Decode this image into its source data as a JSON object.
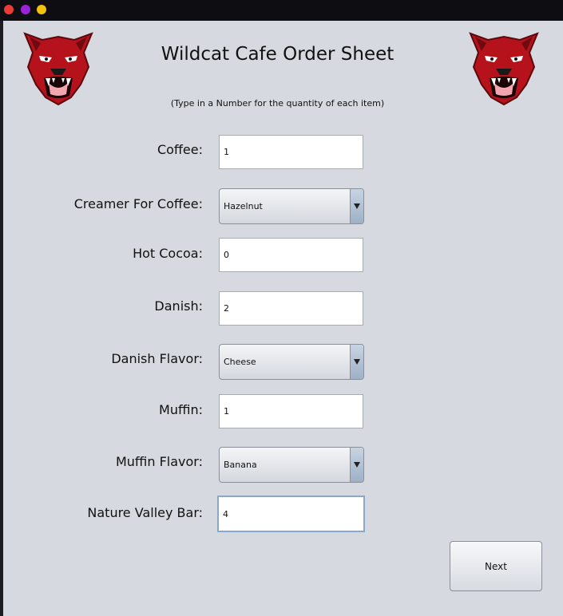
{
  "window": {
    "controls": [
      "close-dot",
      "minimize-dot",
      "maximize-dot"
    ]
  },
  "header": {
    "title": "Wildcat Cafe Order Sheet",
    "subtitle": "(Type in a Number for the quantity of each item)",
    "logo_icon": "wildcat-mascot-icon"
  },
  "form": {
    "coffee": {
      "label": "Coffee:",
      "value": "1"
    },
    "creamer": {
      "label": "Creamer For Coffee:",
      "value": "Hazelnut"
    },
    "hot_cocoa": {
      "label": "Hot Cocoa:",
      "value": "0"
    },
    "danish": {
      "label": "Danish:",
      "value": "2"
    },
    "danish_flavor": {
      "label": "Danish Flavor:",
      "value": "Cheese"
    },
    "muffin": {
      "label": "Muffin:",
      "value": "1"
    },
    "muffin_flavor": {
      "label": "Muffin Flavor:",
      "value": "Banana"
    },
    "nature_valley": {
      "label": "Nature Valley Bar:",
      "value": "4"
    }
  },
  "actions": {
    "next_label": "Next"
  },
  "colors": {
    "background": "#d6d9df",
    "titlebar": "#0e0e12",
    "close": "#ec3b35",
    "minimize": "#9a22d8",
    "maximize": "#f2c20c",
    "mascot_red": "#b5121b",
    "focus_border": "#8aa9c9"
  }
}
